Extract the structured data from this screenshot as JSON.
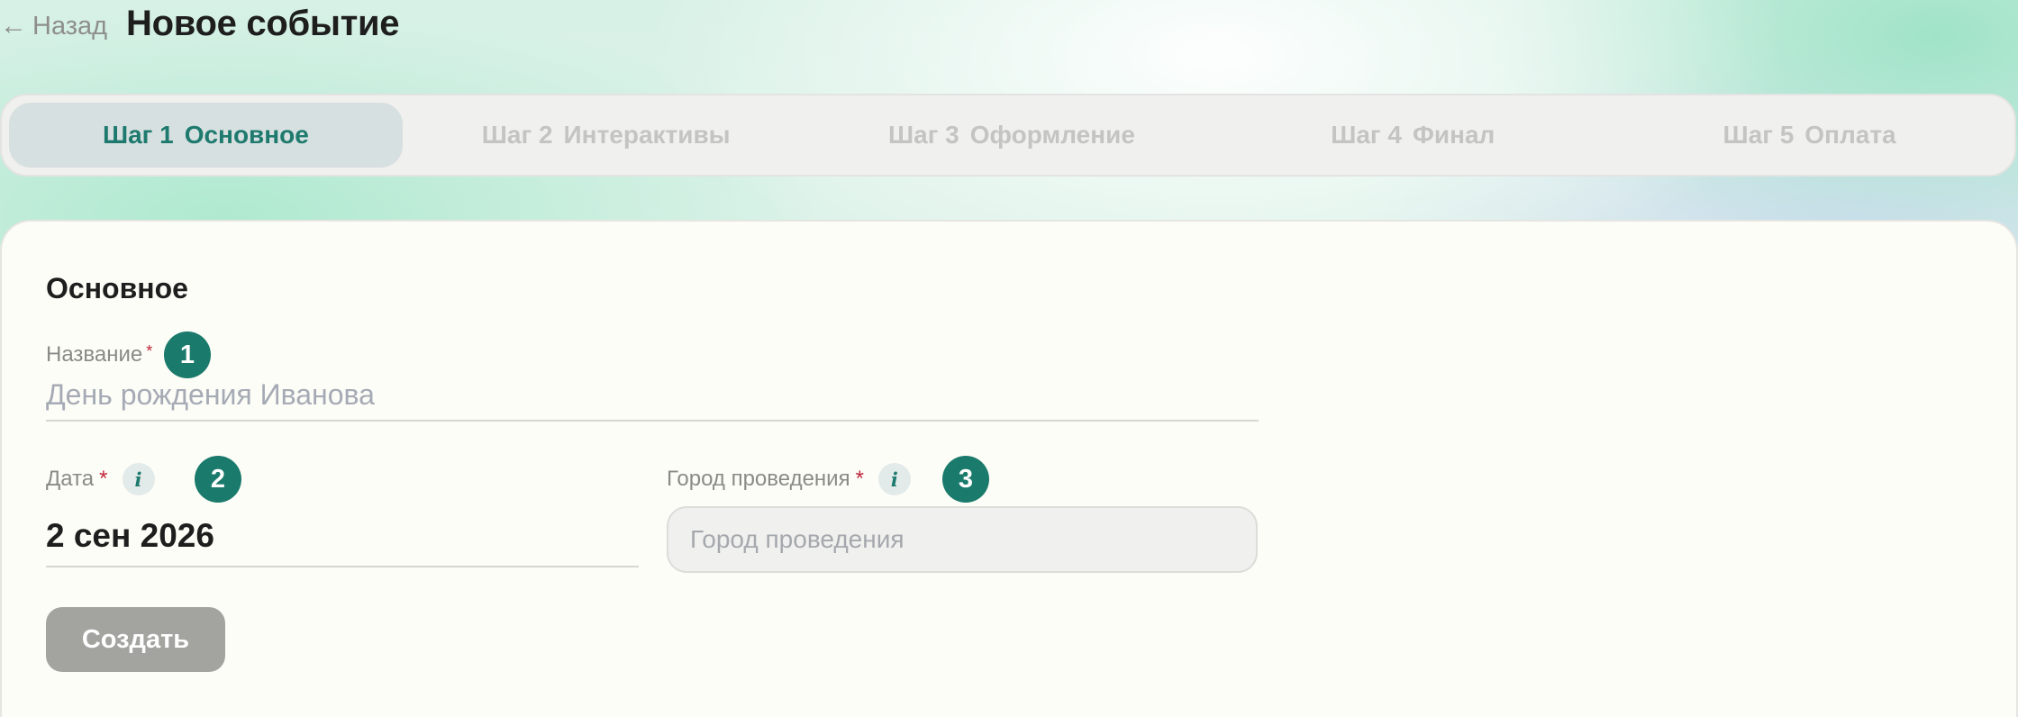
{
  "header": {
    "back_arrow": "←",
    "back_label": "Назад",
    "title": "Новое событие"
  },
  "stepper": {
    "steps": [
      {
        "num": "Шаг 1",
        "label": "Основное",
        "active": true
      },
      {
        "num": "Шаг 2",
        "label": "Интерактивы",
        "active": false
      },
      {
        "num": "Шаг 3",
        "label": "Оформление",
        "active": false
      },
      {
        "num": "Шаг 4",
        "label": "Финал",
        "active": false
      },
      {
        "num": "Шаг 5",
        "label": "Оплата",
        "active": false
      }
    ]
  },
  "form": {
    "section_title": "Основное",
    "name_field": {
      "label": "Название",
      "required_mark": "*",
      "value": "",
      "placeholder": "День рождения Иванова",
      "badge": "1"
    },
    "date_field": {
      "label": "Дата",
      "required_mark": "*",
      "info_icon": "i",
      "value": "2 сен 2026",
      "badge": "2"
    },
    "city_field": {
      "label": "Город проведения",
      "required_mark": "*",
      "info_icon": "i",
      "value": "",
      "placeholder": "Город проведения",
      "badge": "3"
    },
    "submit_label": "Создать"
  },
  "icons": {
    "back": "arrow-left-icon",
    "info": "info-icon"
  },
  "colors": {
    "accent": "#1a7a6c",
    "required": "#c0283c",
    "button_disabled": "#a3a3a0"
  }
}
